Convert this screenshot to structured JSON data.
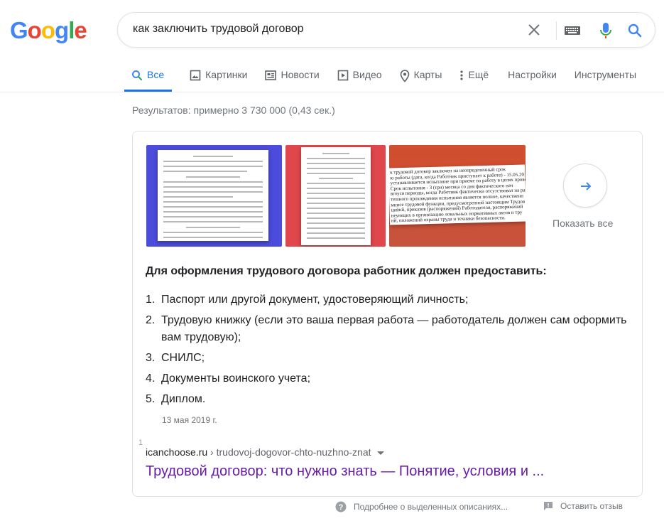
{
  "logo": {
    "letters": [
      "G",
      "o",
      "o",
      "g",
      "l",
      "e"
    ],
    "colors": [
      "#4285f4",
      "#ea4335",
      "#fbbc05",
      "#4285f4",
      "#34a853",
      "#ea4335"
    ]
  },
  "search": {
    "query": "как заключить трудовой договор"
  },
  "tabs": [
    {
      "label": "Все",
      "icon": "search-icon",
      "active": true
    },
    {
      "label": "Картинки",
      "icon": "image-icon"
    },
    {
      "label": "Новости",
      "icon": "news-icon"
    },
    {
      "label": "Видео",
      "icon": "video-icon"
    },
    {
      "label": "Карты",
      "icon": "map-pin-icon"
    },
    {
      "label": "Ещё",
      "icon": "more-vert-icon"
    },
    {
      "label": "Настройки"
    },
    {
      "label": "Инструменты"
    }
  ],
  "stats": "Результатов: примерно 3 730 000 (0,43 сек.)",
  "snippet": {
    "thumbnails": [
      {
        "bg": "#4b4cdc"
      },
      {
        "bg": "#e0474c"
      },
      {
        "bg": "#cf4f33",
        "text_lines": [
          "к трудовой договор заключен на неопределенный срок",
          "ю работы (дата, когда Работник приступает к работе) - 15.05.2014",
          "устанавливается испытание при приеме на работу в целях провер",
          "Срок испытания - 3 (три) месяца со дня фактического нач",
          "вгоуся периоды, когда Работник фактически отсутствовал на работ",
          "тешного прохождения испытания является полное, качественн",
          "мнисе трудовой функции, предусмотренной настоящим Трудов",
          "цийнй, приказов (распоряжений) Работодателя, распоряжений",
          "неующих в организацию локальных нормативных актов и тру",
          "нй, положений охраны труда и техники безопасности."
        ]
      }
    ],
    "show_all": "Показать все",
    "heading": "Для оформления трудового договора работник должен предоставить:",
    "items": [
      {
        "num": "1.",
        "text": "Паспорт или другой документ, удостоверяющий личность;"
      },
      {
        "num": "2.",
        "text": "Трудовую книжку (если это ваша первая работа — работодатель должен сам оформить вам трудовую);"
      },
      {
        "num": "3.",
        "text": "СНИЛС;"
      },
      {
        "num": "4.",
        "text": "Документы воинского учета;"
      },
      {
        "num": "5.",
        "text": "Диплом."
      }
    ],
    "date": "13 мая 2019 г.",
    "small_number": "1",
    "cite_domain": "icanchoose.ru",
    "cite_path": " › trudovoj-dogovor-chto-nuzhno-znat",
    "result_title": "Трудовой договор: что нужно знать — Понятие, условия и ..."
  },
  "footer": {
    "about": "Подробнее о выделенных описаниях...",
    "feedback": "Оставить отзыв"
  },
  "colors": {
    "link_visited": "#681da8",
    "accent": "#1a73e8"
  }
}
